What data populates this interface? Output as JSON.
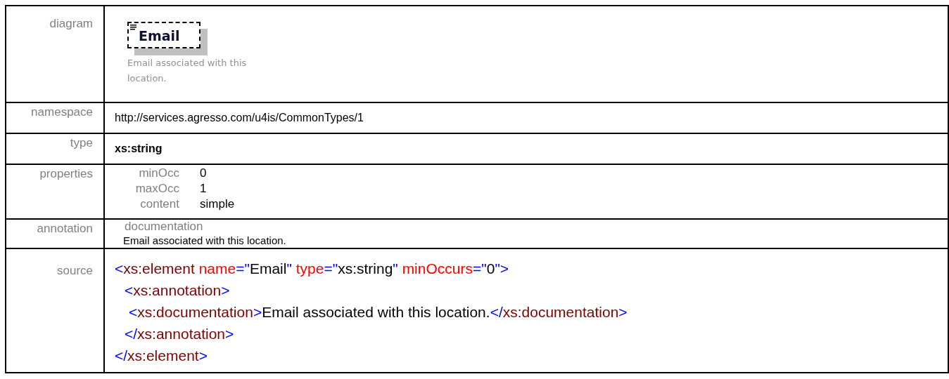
{
  "rows": [
    {
      "kind": "diagram",
      "label": "diagram",
      "element_name": "Email",
      "caption": "Email associated with this location."
    },
    {
      "kind": "text",
      "label": "namespace",
      "value": "http://services.agresso.com/u4is/CommonTypes/1",
      "bold": false
    },
    {
      "kind": "text",
      "label": "type",
      "value": "xs:string",
      "bold": true
    },
    {
      "kind": "properties",
      "label": "properties",
      "items": [
        {
          "name": "minOcc",
          "value": "0"
        },
        {
          "name": "maxOcc",
          "value": "1"
        },
        {
          "name": "content",
          "value": "simple"
        }
      ]
    },
    {
      "kind": "annotation",
      "label": "annotation",
      "heading": "documentation",
      "text": "Email associated with this location."
    },
    {
      "kind": "source",
      "label": "source",
      "lines": [
        {
          "tokens": [
            {
              "kind": "punct",
              "text": "<"
            },
            {
              "kind": "tag",
              "text": "xs:element"
            },
            {
              "kind": "attr",
              "text": " name"
            },
            {
              "kind": "punct",
              "text": "=\""
            },
            {
              "kind": "text",
              "text": "Email"
            },
            {
              "kind": "punct",
              "text": "\""
            },
            {
              "kind": "attr",
              "text": " type"
            },
            {
              "kind": "punct",
              "text": "=\""
            },
            {
              "kind": "text",
              "text": "xs:string"
            },
            {
              "kind": "punct",
              "text": "\""
            },
            {
              "kind": "attr",
              "text": " minOccurs"
            },
            {
              "kind": "punct",
              "text": "=\""
            },
            {
              "kind": "text",
              "text": "0"
            },
            {
              "kind": "punct",
              "text": "\">"
            }
          ],
          "children": [
            {
              "tokens": [
                {
                  "kind": "punct",
                  "text": "<"
                },
                {
                  "kind": "tag",
                  "text": "xs:annotation"
                },
                {
                  "kind": "punct",
                  "text": ">"
                }
              ],
              "children": [
                {
                  "tokens": [
                    {
                      "kind": "punct",
                      "text": "<"
                    },
                    {
                      "kind": "tag",
                      "text": "xs:documentation"
                    },
                    {
                      "kind": "punct",
                      "text": ">"
                    },
                    {
                      "kind": "text",
                      "text": "Email associated with this location."
                    },
                    {
                      "kind": "punct",
                      "text": "</"
                    },
                    {
                      "kind": "tag",
                      "text": "xs:documentation"
                    },
                    {
                      "kind": "punct",
                      "text": ">"
                    }
                  ]
                }
              ]
            },
            {
              "tokens": [
                {
                  "kind": "punct",
                  "text": "</"
                },
                {
                  "kind": "tag",
                  "text": "xs:annotation"
                },
                {
                  "kind": "punct",
                  "text": ">"
                }
              ]
            }
          ]
        },
        {
          "tokens": [
            {
              "kind": "punct",
              "text": "</"
            },
            {
              "kind": "tag",
              "text": "xs:element"
            },
            {
              "kind": "punct",
              "text": ">"
            }
          ]
        }
      ]
    }
  ]
}
